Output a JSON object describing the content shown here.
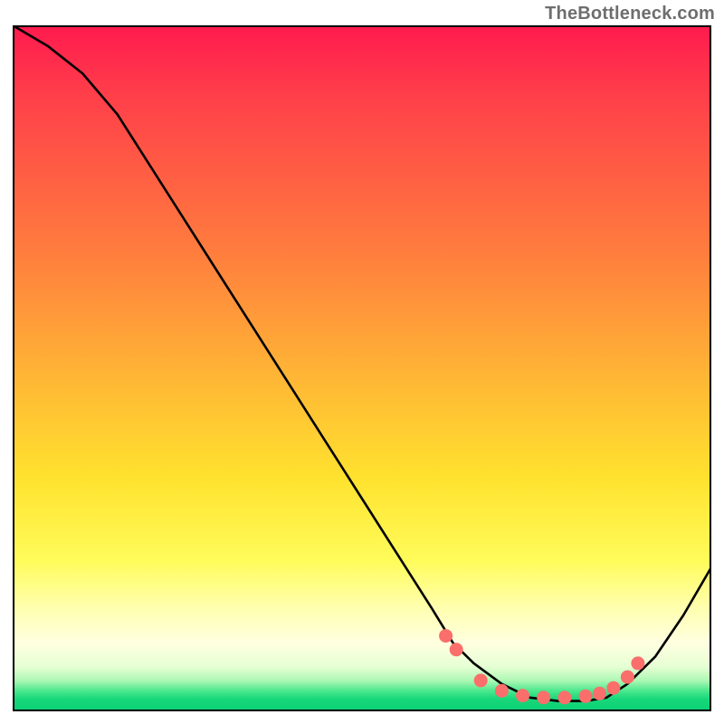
{
  "attribution": "TheBottleneck.com",
  "chart_data": {
    "type": "line",
    "title": "",
    "xlabel": "",
    "ylabel": "",
    "xlim": [
      0,
      100
    ],
    "ylim": [
      0,
      100
    ],
    "background": "gradient red→yellow→green (bottleneck risk style)",
    "series": [
      {
        "name": "bottleneck-curve",
        "x": [
          0,
          5,
          10,
          15,
          20,
          25,
          30,
          35,
          40,
          45,
          50,
          55,
          60,
          63,
          66,
          70,
          74,
          78,
          82,
          85,
          88,
          92,
          96,
          100
        ],
        "y": [
          100,
          97,
          93,
          87,
          79,
          71,
          63,
          55,
          47,
          39,
          31,
          23,
          15,
          10,
          7,
          4,
          2,
          1.5,
          1.5,
          2,
          4,
          8,
          14,
          21
        ]
      }
    ],
    "markers": {
      "name": "highlight-dots",
      "x": [
        62,
        63.5,
        67,
        70,
        73,
        76,
        79,
        82,
        84,
        86,
        88,
        89.5
      ],
      "y": [
        11,
        9,
        4.5,
        3,
        2.3,
        2,
        2,
        2.2,
        2.6,
        3.4,
        5,
        7
      ]
    }
  }
}
